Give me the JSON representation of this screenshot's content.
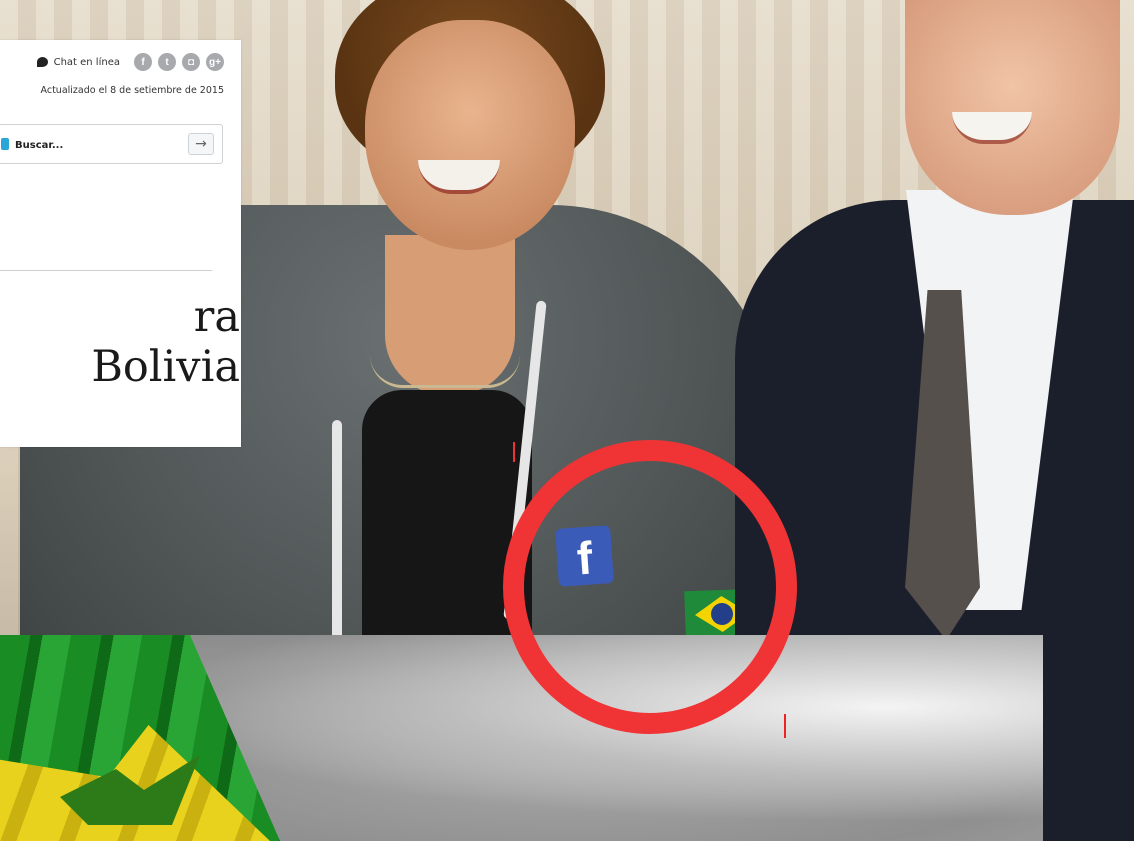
{
  "header": {
    "chat_label": "Chat en línea",
    "social_icons": [
      "facebook-icon",
      "twitter-icon",
      "instagram-icon",
      "google-plus-icon"
    ],
    "updated_text": "Actualizado el 8 de setiembre de 2015"
  },
  "search": {
    "placeholder": "Buscar...",
    "button_glyph": "→"
  },
  "article": {
    "headline_line1": "ra",
    "headline_line2": "Bolivia"
  },
  "photo": {
    "patch_letter": "f"
  },
  "colors": {
    "annotation_circle": "#f03335",
    "search_accent": "#29a7d8",
    "social_icon_bg": "#a7a9ac"
  }
}
